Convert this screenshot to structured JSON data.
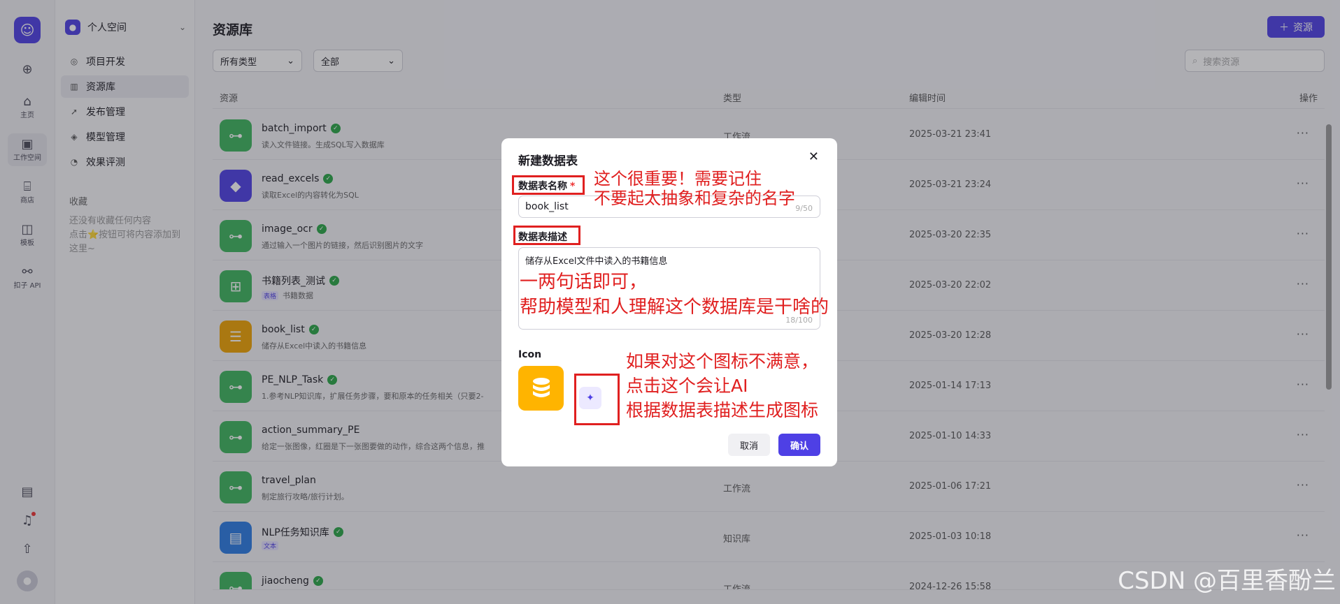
{
  "rail": {
    "items": [
      {
        "label": "主页"
      },
      {
        "label": "工作空间"
      },
      {
        "label": "商店"
      },
      {
        "label": "模板"
      },
      {
        "label": "扣子 API"
      }
    ]
  },
  "sidebar": {
    "space": "个人空间",
    "nav": [
      {
        "label": "项目开发"
      },
      {
        "label": "资源库"
      },
      {
        "label": "发布管理"
      },
      {
        "label": "模型管理"
      },
      {
        "label": "效果评测"
      }
    ],
    "favorites_title": "收藏",
    "favorites_empty_1": "还没有收藏任何内容",
    "favorites_empty_2": "点击⭐按钮可将内容添加到这里~"
  },
  "main": {
    "title": "资源库",
    "add_button": "资源",
    "filter_type": "所有类型",
    "filter_scope": "全部",
    "search_placeholder": "搜索资源",
    "columns": {
      "resource": "资源",
      "type": "类型",
      "edited": "编辑时间",
      "actions": "操作"
    },
    "rows": [
      {
        "name": "batch_import",
        "desc": "读入文件链接。生成SQL写入数据库",
        "tag": "",
        "type": "工作流",
        "time": "2025-03-21 23:41",
        "color": "#3cb55c"
      },
      {
        "name": "read_excels",
        "desc": "读取Excel的内容转化为SQL",
        "tag": "",
        "type": "",
        "time": "2025-03-21 23:24",
        "color": "#4e40e5"
      },
      {
        "name": "image_ocr",
        "desc": "通过输入一个图片的链接，然后识别图片的文字",
        "tag": "",
        "type": "",
        "time": "2025-03-20 22:35",
        "color": "#3cb55c"
      },
      {
        "name": "书籍列表_测试",
        "desc": "书籍数据",
        "tag": "表格",
        "type": "",
        "time": "2025-03-20 22:02",
        "color": "#3cb55c"
      },
      {
        "name": "book_list",
        "desc": "储存从Excel中读入的书籍信息",
        "tag": "",
        "type": "",
        "time": "2025-03-20 12:28",
        "color": "#f0a400"
      },
      {
        "name": "PE_NLP_Task",
        "desc": "1.参考NLP知识库，扩展任务步骤，要和原本的任务相关（只要2-",
        "tag": "",
        "type": "",
        "time": "2025-01-14 17:13",
        "color": "#3cb55c"
      },
      {
        "name": "action_summary_PE",
        "desc": "给定一张图像，红圈是下一张图要做的动作，综合这两个信息，推",
        "tag": "",
        "type": "",
        "time": "2025-01-10 14:33",
        "color": "#3cb55c"
      },
      {
        "name": "travel_plan",
        "desc": "制定旅行攻略/旅行计划。",
        "tag": "",
        "type": "工作流",
        "time": "2025-01-06 17:21",
        "color": "#3cb55c"
      },
      {
        "name": "NLP任务知识库",
        "desc": "",
        "tag": "文本",
        "type": "知识库",
        "time": "2025-01-03 10:18",
        "color": "#2a7be4"
      },
      {
        "name": "jiaocheng",
        "desc": "",
        "tag": "",
        "type": "工作流",
        "time": "2024-12-26 15:58",
        "color": "#3cb55c"
      }
    ]
  },
  "modal": {
    "title": "新建数据表",
    "name_label": "数据表名称",
    "name_value": "book_list",
    "name_count": "9/50",
    "desc_label": "数据表描述",
    "desc_value": "储存从Excel文件中读入的书籍信息",
    "desc_count": "18/100",
    "icon_label": "Icon",
    "cancel": "取消",
    "confirm": "确认"
  },
  "annotations": {
    "name_note_1": "这个很重要！需要记住",
    "name_note_2": "不要起太抽象和复杂的名字",
    "desc_note_1": "一两句话即可，",
    "desc_note_2": "帮助模型和人理解这个数据库是干啥的",
    "icon_note_1": "如果对这个图标不满意，",
    "icon_note_2": "点击这个会让AI",
    "icon_note_3": "根据数据表描述生成图标"
  },
  "watermark": "CSDN @百里香酚兰"
}
